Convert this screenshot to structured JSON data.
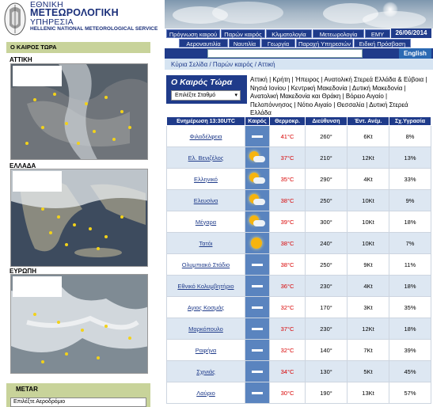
{
  "org": {
    "line1": "ΕΘΝΙΚΗ",
    "line2": "ΜΕΤΕΩΡΟΛΟΓΙΚΗ",
    "line3": "ΥΠΗΡΕΣΙΑ",
    "line4": "HELLENIC NATIONAL METEOROLOGICAL SERVICE"
  },
  "nav": {
    "row1": [
      "Πρόγνωση καιρού",
      "Παρών καιρός",
      "Κλιματολογία",
      "Μετεωρολογία",
      "ΕΜΥ"
    ],
    "row2": [
      "Αεροναυτιλία",
      "Ναυτιλία",
      "Γεωργία",
      "Παροχή Υπηρεσιών",
      "Ειδική Πρόσβαση"
    ],
    "date": "26/06/2014",
    "english_label": "English",
    "search_placeholder": ""
  },
  "breadcrumb": "Κύρια Σελίδα / Παρών καιρός / Αττική",
  "left": {
    "now_title": "Ο ΚΑΙΡΟΣ ΤΩΡΑ",
    "regions": [
      "ΑΤΤΙΚΗ",
      "ΕΛΛΑΔΑ",
      "ΕΥΡΩΠΗ"
    ],
    "metar_title": "METAR",
    "metar_select": "Επιλέξτε Αεροδρόμιο"
  },
  "current": {
    "title": "Ο Καιρός Τώρα",
    "station_select": "Επιλέξτε Σταθμό",
    "regions_text": "Αττική | Κρήτη | Ήπειρος | Ανατολική Στερεά Ελλάδα & Εύβοια | Νησιά Ιονίου | Κεντρική Μακεδονία | Δυτική Μακεδονία | Ανατολική Μακεδονία και Θράκη | Βόρειο Αιγαίο | Πελοπόννησος | Νότιο Αιγαίο | Θεσσαλία | Δυτική Στερεά Ελλάδα"
  },
  "table": {
    "headers": [
      "Ενημέρωση 13:30UTC",
      "Καιρός",
      "Θερμοκρ.",
      "Διεύθυνση",
      "Έντ. Ανέμ.",
      "Σχ.Υγρασία"
    ],
    "rows": [
      {
        "station": "Φιλαδέλφεια",
        "icon": "clear-dash",
        "temp": "41°C",
        "dir": "260°",
        "wind": "6Kt",
        "hum": "8%"
      },
      {
        "station": "Ελ. Βενιζέλος",
        "icon": "sun-cloud",
        "temp": "37°C",
        "dir": "210°",
        "wind": "12Kt",
        "hum": "13%"
      },
      {
        "station": "Ελληνικό",
        "icon": "sun-cloud",
        "temp": "35°C",
        "dir": "290°",
        "wind": "4Kt",
        "hum": "33%"
      },
      {
        "station": "Ελευσίνα",
        "icon": "sun-cloud",
        "temp": "38°C",
        "dir": "250°",
        "wind": "10Kt",
        "hum": "9%"
      },
      {
        "station": "Μέγαρα",
        "icon": "sun-cloud",
        "temp": "39°C",
        "dir": "300°",
        "wind": "10Kt",
        "hum": "18%"
      },
      {
        "station": "Τατόι",
        "icon": "sun",
        "temp": "38°C",
        "dir": "240°",
        "wind": "10Kt",
        "hum": "7%"
      },
      {
        "station": "Ολυμπιακό Στάδιο",
        "icon": "clear-dash",
        "temp": "38°C",
        "dir": "250°",
        "wind": "9Kt",
        "hum": "11%"
      },
      {
        "station": "Εθνικό Κολυμβητήριο",
        "icon": "clear-dash",
        "temp": "36°C",
        "dir": "230°",
        "wind": "4Kt",
        "hum": "18%"
      },
      {
        "station": "Αγιος Κοσμάς",
        "icon": "clear-dash",
        "temp": "32°C",
        "dir": "170°",
        "wind": "3Kt",
        "hum": "35%"
      },
      {
        "station": "Μαρκόπουλο",
        "icon": "clear-dash",
        "temp": "37°C",
        "dir": "230°",
        "wind": "12Kt",
        "hum": "18%"
      },
      {
        "station": "Ραφήνα",
        "icon": "clear-dash",
        "temp": "32°C",
        "dir": "140°",
        "wind": "7Kt",
        "hum": "39%"
      },
      {
        "station": "Σχινιάς",
        "icon": "clear-dash",
        "temp": "34°C",
        "dir": "130°",
        "wind": "5Kt",
        "hum": "45%"
      },
      {
        "station": "Λαύριο",
        "icon": "clear-dash",
        "temp": "30°C",
        "dir": "190°",
        "wind": "13Kt",
        "hum": "57%"
      }
    ]
  }
}
